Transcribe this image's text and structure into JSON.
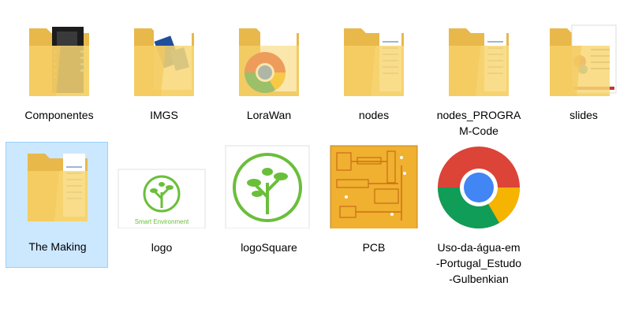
{
  "window": {
    "background": "#ffffff",
    "selection_fill": "#cce8ff",
    "selection_border": "#99d1ff"
  },
  "files": [
    {
      "name": "Componentes",
      "type": "folder",
      "preview": "circuit-board",
      "selected": false
    },
    {
      "name": "IMGS",
      "type": "folder",
      "preview": "blue-module",
      "selected": false
    },
    {
      "name": "LoraWan",
      "type": "folder",
      "preview": "chrome-logo",
      "selected": false
    },
    {
      "name": "nodes",
      "type": "folder",
      "preview": "document",
      "selected": false
    },
    {
      "name": "nodes_PROGRA\nM-Code",
      "type": "folder",
      "preview": "document",
      "selected": false
    },
    {
      "name": "slides",
      "type": "folder",
      "preview": "slides-document",
      "selected": false
    },
    {
      "name": "The Making",
      "type": "folder",
      "preview": "document",
      "selected": true
    },
    {
      "name": "logo",
      "type": "image",
      "preview": "smart-environment-logo",
      "caption": "Smart Environment",
      "selected": false
    },
    {
      "name": "logoSquare",
      "type": "image",
      "preview": "tree-logo",
      "selected": false
    },
    {
      "name": "PCB",
      "type": "image",
      "preview": "pcb-layout",
      "selected": false
    },
    {
      "name": "Uso-da-água-em\n-Portugal_Estudo\n-Gulbenkian",
      "type": "shortcut",
      "preview": "chrome-icon",
      "selected": false
    }
  ]
}
